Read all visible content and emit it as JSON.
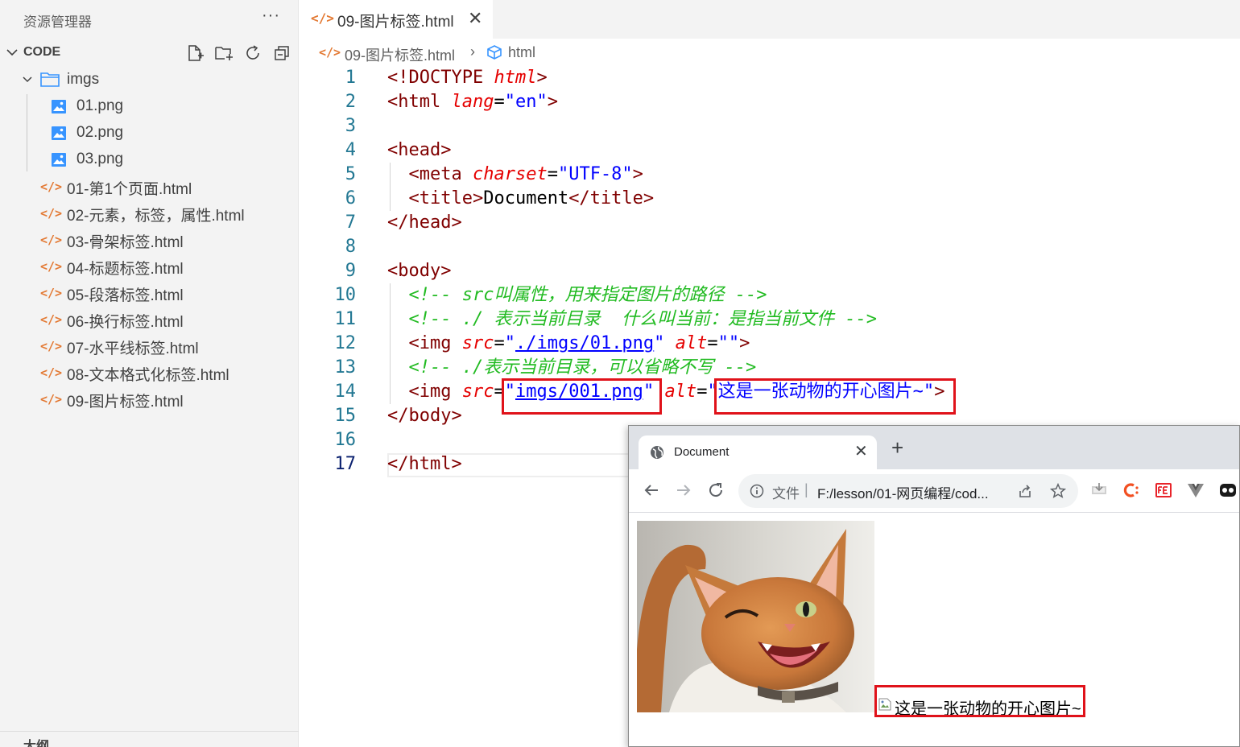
{
  "sidebar": {
    "title": "资源管理器",
    "more": "···",
    "folder": "CODE",
    "tree": [
      {
        "label": "imgs",
        "kind": "folder"
      },
      {
        "label": "01.png",
        "kind": "image"
      },
      {
        "label": "02.png",
        "kind": "image"
      },
      {
        "label": "03.png",
        "kind": "image"
      },
      {
        "label": "01-第1个页面.html",
        "kind": "html"
      },
      {
        "label": "02-元素，标签，属性.html",
        "kind": "html"
      },
      {
        "label": "03-骨架标签.html",
        "kind": "html"
      },
      {
        "label": "04-标题标签.html",
        "kind": "html"
      },
      {
        "label": "05-段落标签.html",
        "kind": "html"
      },
      {
        "label": "06-换行标签.html",
        "kind": "html"
      },
      {
        "label": "07-水平线标签.html",
        "kind": "html"
      },
      {
        "label": "08-文本格式化标签.html",
        "kind": "html"
      },
      {
        "label": "09-图片标签.html",
        "kind": "html"
      }
    ],
    "outline": "大纲"
  },
  "editor": {
    "tab": {
      "icon": "</>",
      "label": "09-图片标签.html",
      "close": "✕"
    },
    "breadcrumb": {
      "icon": "</>",
      "file": "09-图片标签.html",
      "sep": "›",
      "symbol": "html"
    },
    "current_line": 17,
    "lines": [
      {
        "n": "1",
        "tokens": [
          {
            "t": "tg",
            "v": "<!DOCTYPE "
          },
          {
            "t": "at",
            "v": "html"
          },
          {
            "t": "tg",
            "v": ">"
          }
        ]
      },
      {
        "n": "2",
        "tokens": [
          {
            "t": "tg",
            "v": "<html "
          },
          {
            "t": "at",
            "v": "lang"
          },
          {
            "t": "pl",
            "v": "="
          },
          {
            "t": "st",
            "v": "\"en\""
          },
          {
            "t": "tg",
            "v": ">"
          }
        ]
      },
      {
        "n": "3",
        "tokens": []
      },
      {
        "n": "4",
        "tokens": [
          {
            "t": "tg",
            "v": "<head>"
          }
        ]
      },
      {
        "n": "5",
        "tokens": [
          {
            "t": "pl",
            "v": "  "
          },
          {
            "t": "tg",
            "v": "<meta "
          },
          {
            "t": "at",
            "v": "charset"
          },
          {
            "t": "pl",
            "v": "="
          },
          {
            "t": "st",
            "v": "\"UTF-8\""
          },
          {
            "t": "tg",
            "v": ">"
          }
        ]
      },
      {
        "n": "6",
        "tokens": [
          {
            "t": "pl",
            "v": "  "
          },
          {
            "t": "tg",
            "v": "<title>"
          },
          {
            "t": "pl",
            "v": "Document"
          },
          {
            "t": "tg",
            "v": "</title>"
          }
        ]
      },
      {
        "n": "7",
        "tokens": [
          {
            "t": "tg",
            "v": "</head>"
          }
        ]
      },
      {
        "n": "8",
        "tokens": []
      },
      {
        "n": "9",
        "tokens": [
          {
            "t": "tg",
            "v": "<body>"
          }
        ]
      },
      {
        "n": "10",
        "tokens": [
          {
            "t": "pl",
            "v": "  "
          },
          {
            "t": "cm",
            "v": "<!-- src叫属性，用来指定图片的路径 -->"
          }
        ]
      },
      {
        "n": "11",
        "tokens": [
          {
            "t": "pl",
            "v": "  "
          },
          {
            "t": "cm",
            "v": "<!-- ./ 表示当前目录  什么叫当前：是指当前文件 -->"
          }
        ]
      },
      {
        "n": "12",
        "tokens": [
          {
            "t": "pl",
            "v": "  "
          },
          {
            "t": "tg",
            "v": "<img "
          },
          {
            "t": "at",
            "v": "src"
          },
          {
            "t": "pl",
            "v": "="
          },
          {
            "t": "st",
            "v": "\""
          },
          {
            "t": "lk",
            "v": "./imgs/01.png"
          },
          {
            "t": "st",
            "v": "\""
          },
          {
            "t": "pl",
            "v": " "
          },
          {
            "t": "at",
            "v": "alt"
          },
          {
            "t": "pl",
            "v": "="
          },
          {
            "t": "st",
            "v": "\"\""
          },
          {
            "t": "tg",
            "v": ">"
          }
        ]
      },
      {
        "n": "13",
        "tokens": [
          {
            "t": "pl",
            "v": "  "
          },
          {
            "t": "cm",
            "v": "<!-- ./表示当前目录，可以省略不写 -->"
          }
        ]
      },
      {
        "n": "14",
        "tokens": [
          {
            "t": "pl",
            "v": "  "
          },
          {
            "t": "tg",
            "v": "<img "
          },
          {
            "t": "at",
            "v": "src"
          },
          {
            "t": "pl",
            "v": "="
          },
          {
            "t": "st",
            "v": "\""
          },
          {
            "t": "lk",
            "v": "imgs/001.png"
          },
          {
            "t": "st",
            "v": "\""
          },
          {
            "t": "pl",
            "v": " "
          },
          {
            "t": "at",
            "v": "alt"
          },
          {
            "t": "pl",
            "v": "="
          },
          {
            "t": "st",
            "v": "\"这是一张动物的开心图片~\""
          },
          {
            "t": "tg",
            "v": ">"
          }
        ]
      },
      {
        "n": "15",
        "tokens": [
          {
            "t": "tg",
            "v": "</body>"
          }
        ]
      },
      {
        "n": "16",
        "tokens": []
      },
      {
        "n": "17",
        "tokens": [
          {
            "t": "tg",
            "v": "</html>"
          }
        ]
      }
    ]
  },
  "browser": {
    "tab_title": "Document",
    "tab_close": "✕",
    "new_tab": "+",
    "scheme_label": "文件",
    "omni_sep": "|",
    "url": "F:/lesson/01-网页编程/cod...",
    "alt_text": "这是一张动物的开心图片~"
  },
  "colors": {
    "sidebar_bg": "#f3f3f3",
    "tag": "#800000",
    "attribute": "#e50000",
    "string": "#0000ff",
    "comment": "#22bb22",
    "line_number": "#237893",
    "html_icon": "#e37933",
    "highlight_box": "#e0121a"
  }
}
